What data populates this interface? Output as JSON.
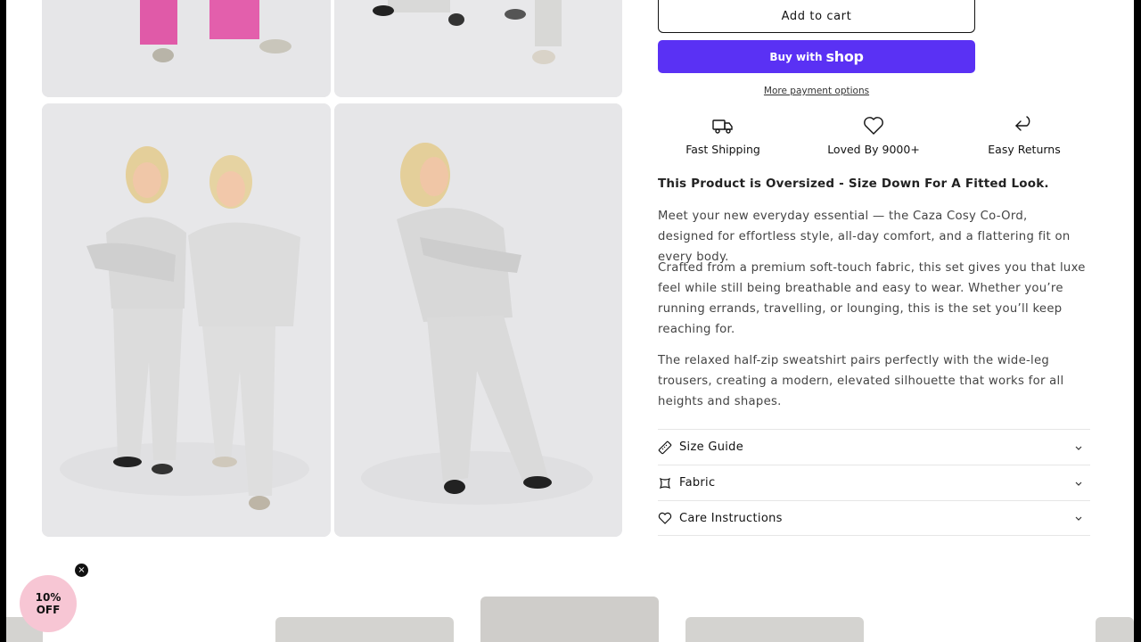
{
  "buy_box": {
    "add_to_cart": "Add to cart",
    "buy_with": "Buy with",
    "shop_brand": "shop",
    "more_payment_options": "More payment options",
    "shop_color": "#5a31f4"
  },
  "features": [
    {
      "icon": "truck-icon",
      "label": "Fast Shipping"
    },
    {
      "icon": "heart-icon",
      "label": "Loved By 9000+"
    },
    {
      "icon": "return-arrow-icon",
      "label": "Easy Returns"
    }
  ],
  "description": {
    "headline": "This Product is Oversized - Size Down For A Fitted Look.",
    "paragraphs": [
      "Meet your new everyday essential — the Caza Cosy Co-Ord, designed for effortless style, all-day comfort, and a flattering fit on every body.",
      "Crafted from a premium soft-touch fabric, this set gives you that luxe feel while still being breathable and easy to wear. Whether you’re running errands, travelling, or lounging, this is the set you’ll keep reaching for.",
      "The relaxed half-zip sweatshirt pairs perfectly with the wide-leg trousers, creating a modern, elevated silhouette that works for all heights and shapes."
    ]
  },
  "accordion": [
    {
      "icon": "ruler-icon",
      "label": "Size Guide"
    },
    {
      "icon": "fabric-icon",
      "label": "Fabric"
    },
    {
      "icon": "heart-icon",
      "label": "Care Instructions"
    }
  ],
  "promo": {
    "line1": "10%",
    "line2": "OFF",
    "close": "×",
    "color": "#f7c6d4"
  }
}
